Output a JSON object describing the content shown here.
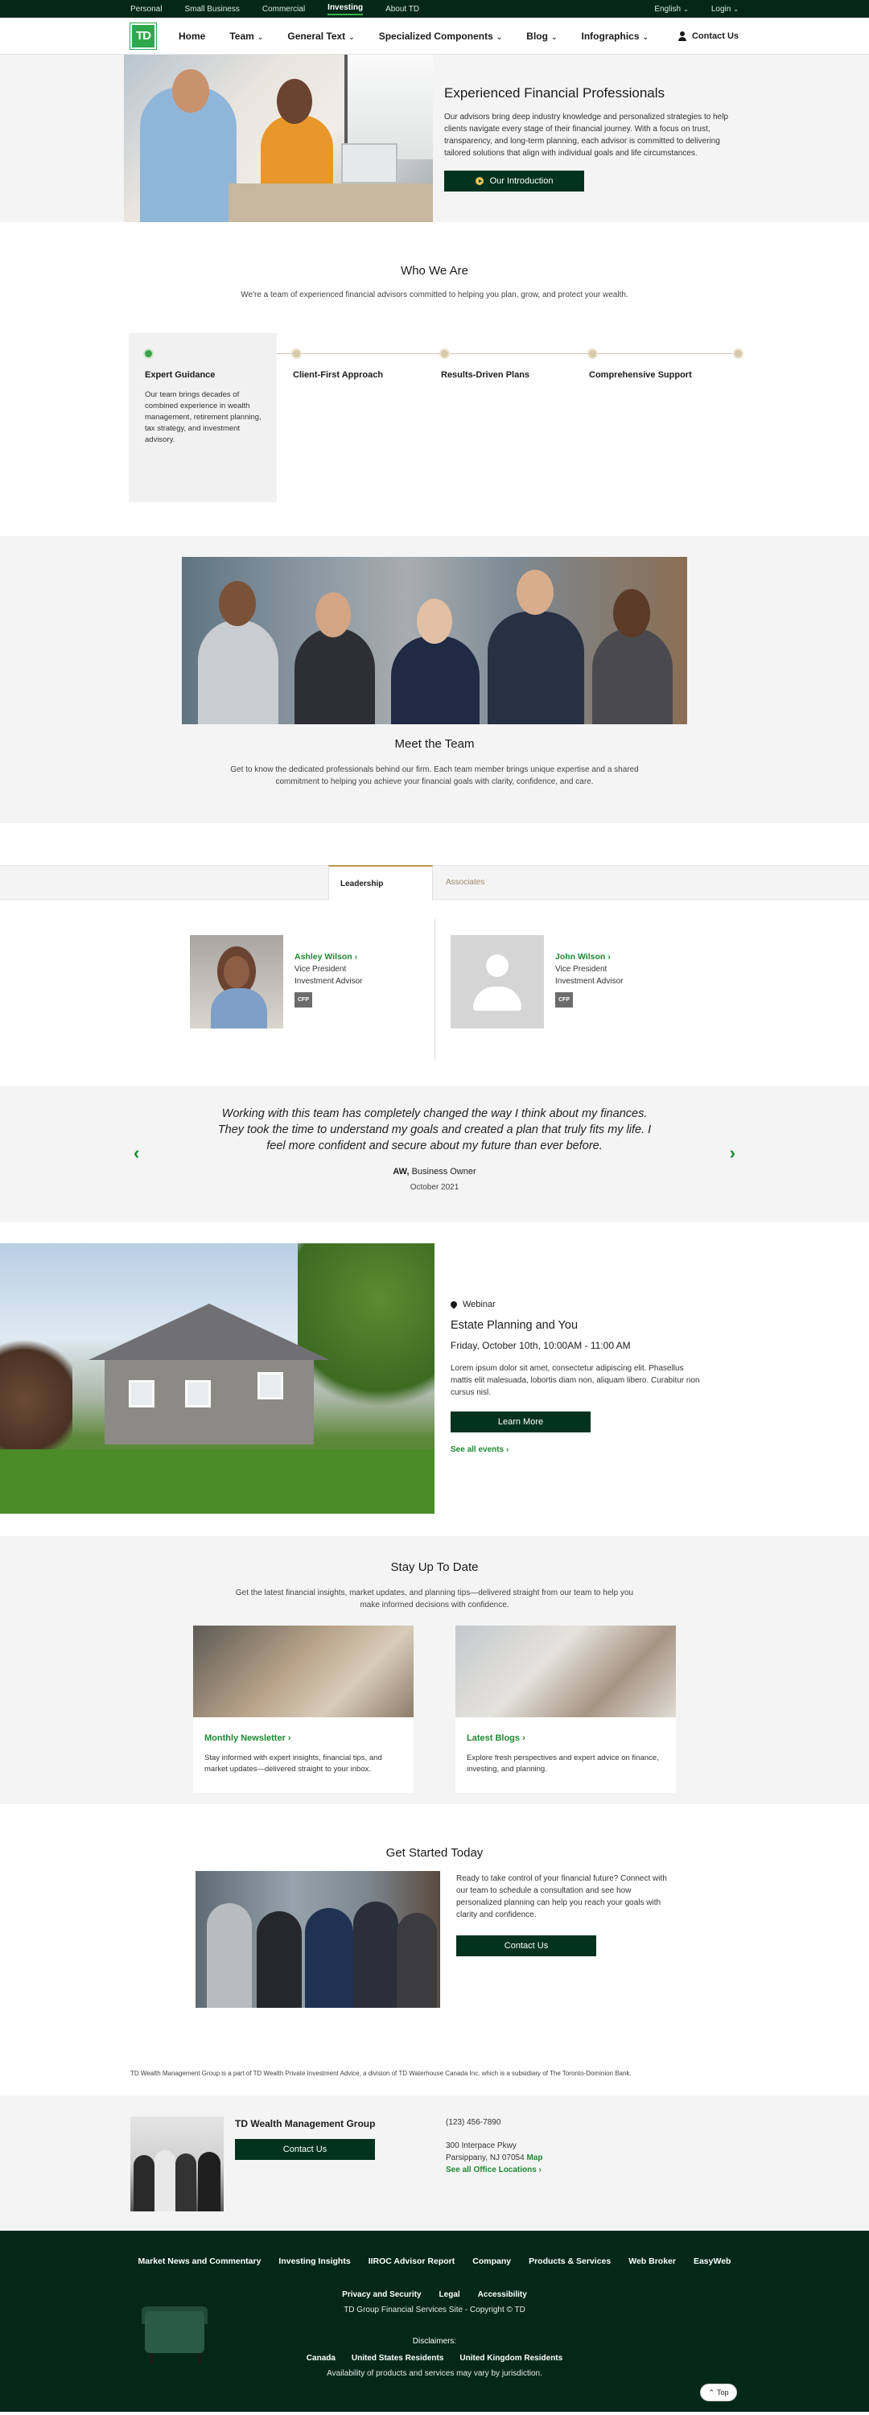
{
  "utility": {
    "left_items": [
      "Personal",
      "Small Business",
      "Commercial",
      "Investing",
      "About TD"
    ],
    "active_index": 3,
    "language": "English",
    "login": "Login"
  },
  "nav": {
    "logo_text": "TD",
    "items": [
      "Home",
      "Team",
      "General Text",
      "Specialized Components",
      "Blog",
      "Infographics"
    ],
    "contact": "Contact Us"
  },
  "hero": {
    "title": "Experienced Financial Professionals",
    "body": "Our advisors bring deep industry knowledge and personalized strategies to help clients navigate every stage of their financial journey. With a focus on trust, transparency, and long-term planning, each advisor is committed to delivering tailored solutions that align with individual goals and life circumstances.",
    "button": "Our Introduction"
  },
  "who": {
    "title": "Who We Are",
    "subtitle": "We're a team of experienced financial advisors committed to helping you plan, grow, and protect your wealth.",
    "steps": [
      {
        "title": "Expert Guidance",
        "body": "Our team brings decades of combined experience in wealth management, retirement planning, tax strategy, and investment advisory."
      },
      {
        "title": "Client-First Approach"
      },
      {
        "title": "Results-Driven Plans"
      },
      {
        "title": "Comprehensive Support"
      }
    ]
  },
  "meet": {
    "title": "Meet the Team",
    "subtitle": "Get to know the dedicated professionals behind our firm. Each team member brings unique expertise and a shared commitment to helping you achieve your financial goals with clarity, confidence, and care."
  },
  "tabs": [
    "Leadership",
    "Associates"
  ],
  "members": [
    {
      "name": "Ashley Wilson",
      "title": "Vice President",
      "role": "Investment Advisor",
      "badge": "CFP"
    },
    {
      "name": "John Wilson",
      "title": "Vice President",
      "role": "Investment Advisor",
      "badge": "CFP"
    }
  ],
  "testimonial": {
    "quote": "Working with this team has completely changed the way I think about my finances. They took the time to understand my goals and created a plan that truly fits my life. I feel more confident and secure about my future than ever before.",
    "initials": "AW,",
    "author": "Business Owner",
    "date": "October 2021"
  },
  "event": {
    "type": "Webinar",
    "title": "Estate Planning and You",
    "when": "Friday, October 10th, 10:00AM - 11:00 AM",
    "body": "Lorem ipsum dolor sit amet, consectetur adipiscing elit. Phasellus mattis elit malesuada, lobortis diam non, aliquam libero. Curabitur non cursus nisl.",
    "button": "Learn More",
    "link": "See all events"
  },
  "stay": {
    "title": "Stay Up To Date",
    "subtitle": "Get the latest financial insights, market updates, and planning tips—delivered straight from our team to help you make informed decisions with confidence.",
    "cards": [
      {
        "title": "Monthly Newsletter",
        "body": "Stay informed with expert insights, financial tips, and market updates—delivered straight to your inbox."
      },
      {
        "title": "Latest Blogs",
        "body": "Explore fresh perspectives and expert advice on finance, investing, and planning."
      }
    ]
  },
  "start": {
    "title": "Get Started Today",
    "body": "Ready to take control of your financial future? Connect with our team to schedule a consultation and see how personalized planning can help you reach your goals with clarity and confidence.",
    "button": "Contact Us"
  },
  "legal": "TD Wealth Management Group is a part of TD Wealth Private Investment Advice, a division of TD Waterhouse Canada Inc. which is a subsidiary of The Toronto-Dominion Bank.",
  "office": {
    "name": "TD Wealth Management Group",
    "button": "Contact Us",
    "phone": "(123) 456-7890",
    "address1": "300 Interpace Pkwy",
    "address2": "Parsippany, NJ 07054",
    "map": "Map",
    "locations": "See all Office Locations"
  },
  "footer": {
    "links": [
      "Market News and Commentary",
      "Investing Insights",
      "IIROC Advisor Report",
      "Company",
      "Products & Services",
      "Web Broker",
      "EasyWeb"
    ],
    "links2": [
      "Privacy and Security",
      "Legal",
      "Accessibility"
    ],
    "site_line": "TD Group Financial Services Site - Copyright © TD",
    "disclaimers_label": "Disclaimers:",
    "regions": [
      "Canada",
      "United States Residents",
      "United Kingdom Residents"
    ],
    "availability": "Availability of products and services may vary by jurisdiction.",
    "top": "Top"
  }
}
